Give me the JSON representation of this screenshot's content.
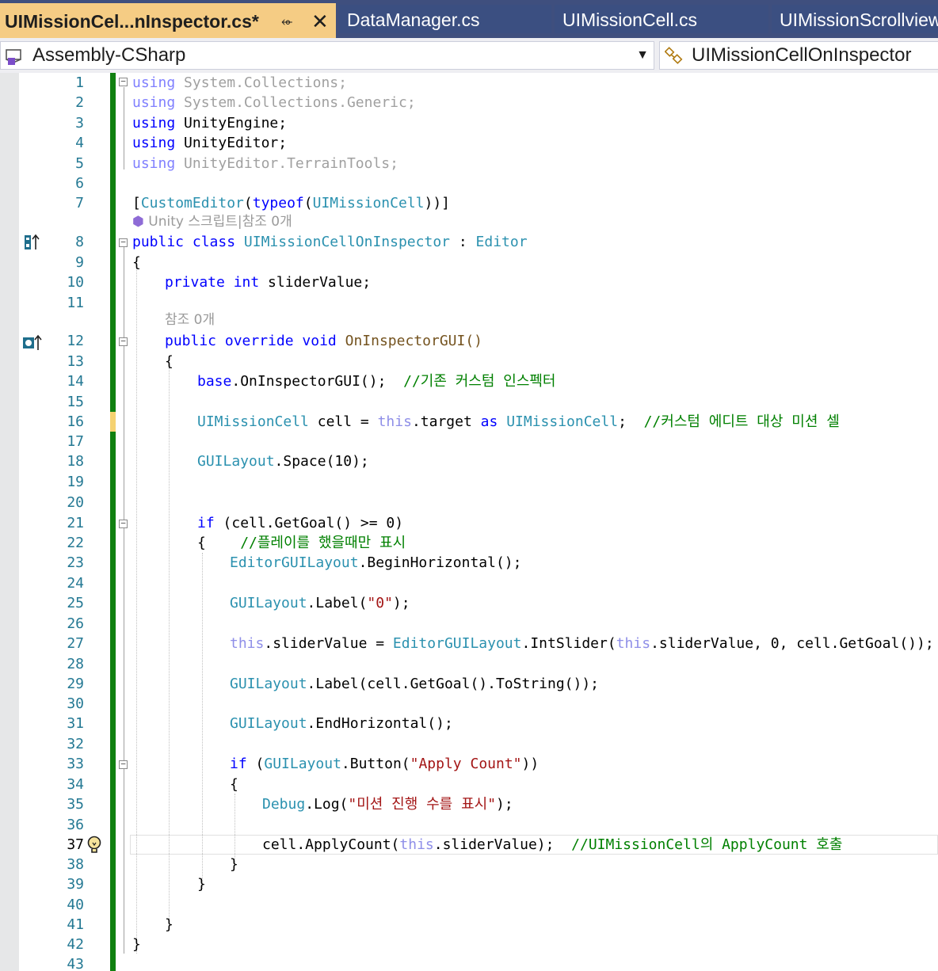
{
  "tabs": [
    {
      "label": "UIMissionCel...nInspector.cs*",
      "active": true
    },
    {
      "label": "DataManager.cs",
      "active": false
    },
    {
      "label": "UIMissionCell.cs",
      "active": false
    },
    {
      "label": "UIMissionScrollview",
      "active": false
    }
  ],
  "tab_icons": {
    "pin": "pin-icon",
    "close": "close-icon"
  },
  "nav": {
    "project": "Assembly-CSharp",
    "member": "UIMissionCellOnInspector",
    "project_icon": "csharp-project-icon",
    "member_icon": "class-member-icon",
    "dropdown_icon": "chevron-down-icon"
  },
  "codelens": {
    "class_refs": "Unity 스크립트|참조 0개",
    "method_refs": "참조 0개"
  },
  "current_line": 37,
  "margin_icons": {
    "line8": "implements-icon",
    "line12": "override-icon",
    "line37": "lightbulb-icon"
  },
  "line_numbers": [
    "1",
    "2",
    "3",
    "4",
    "5",
    "6",
    "7",
    "8",
    "9",
    "10",
    "11",
    "12",
    "13",
    "14",
    "15",
    "16",
    "17",
    "18",
    "19",
    "20",
    "21",
    "22",
    "23",
    "24",
    "25",
    "26",
    "27",
    "28",
    "29",
    "30",
    "31",
    "32",
    "33",
    "34",
    "35",
    "36",
    "37",
    "38",
    "39",
    "40",
    "41",
    "42",
    "43"
  ],
  "code": {
    "l1": [
      "using",
      " ",
      "System",
      ".",
      "Collections",
      ";"
    ],
    "l2": [
      "using",
      " ",
      "System",
      ".",
      "Collections",
      ".",
      "Generic",
      ";"
    ],
    "l3": [
      "using",
      " ",
      "UnityEngine",
      ";"
    ],
    "l4": [
      "using",
      " ",
      "UnityEditor",
      ";"
    ],
    "l5": [
      "using",
      " ",
      "UnityEditor",
      ".",
      "TerrainTools",
      ";"
    ],
    "l7": [
      "[",
      "CustomEditor",
      "(",
      "typeof",
      "(",
      "UIMissionCell",
      "))]"
    ],
    "l8": [
      "public",
      " ",
      "class",
      " ",
      "UIMissionCellOnInspector",
      " : ",
      "Editor"
    ],
    "l9": [
      "{"
    ],
    "l10": [
      "private",
      " ",
      "int",
      " sliderValue;"
    ],
    "l12": [
      "public",
      " ",
      "override",
      " ",
      "void",
      " OnInspectorGUI()"
    ],
    "l13": [
      "{"
    ],
    "l14": [
      "base",
      ".OnInspectorGUI();  ",
      "//기존 커스텀 인스펙터"
    ],
    "l16": [
      "UIMissionCell",
      " cell = ",
      "this",
      ".target ",
      "as",
      " ",
      "UIMissionCell",
      ";  ",
      "//커스텀 에디트 대상 미션 셀"
    ],
    "l18": [
      "GUILayout",
      ".Space(10);"
    ],
    "l21": [
      "if",
      " (cell.GetGoal() >= 0)"
    ],
    "l22": [
      "{    ",
      "//플레이를 했을때만 표시"
    ],
    "l23": [
      "EditorGUILayout",
      ".BeginHorizontal();"
    ],
    "l25": [
      "GUILayout",
      ".Label(",
      "\"0\"",
      ");"
    ],
    "l27": [
      "this",
      ".sliderValue = ",
      "EditorGUILayout",
      ".IntSlider(",
      "this",
      ".sliderValue, 0, cell.GetGoal());"
    ],
    "l29": [
      "GUILayout",
      ".Label(cell.GetGoal().ToString());"
    ],
    "l31": [
      "GUILayout",
      ".EndHorizontal();"
    ],
    "l33": [
      "if",
      " (",
      "GUILayout",
      ".Button(",
      "\"Apply Count\"",
      "))"
    ],
    "l34": [
      "{"
    ],
    "l35": [
      "Debug",
      ".Log(",
      "\"미션 진행 수를 표시\"",
      ");"
    ],
    "l37": [
      "cell.ApplyCount(",
      "this",
      ".sliderValue);  ",
      "//UIMissionCell의 ApplyCount 호출"
    ],
    "l38": [
      "}"
    ],
    "l39": [
      "}"
    ],
    "l41": [
      "}"
    ],
    "l42": [
      "}"
    ]
  },
  "colors": {
    "keyword": "#0000ff",
    "type": "#2b91af",
    "comment": "#008000",
    "string": "#a31515",
    "line_number": "#237893",
    "change_bar": "#108010",
    "active_tab": "#f5cc84",
    "tab_strip": "#3f4f7e"
  }
}
